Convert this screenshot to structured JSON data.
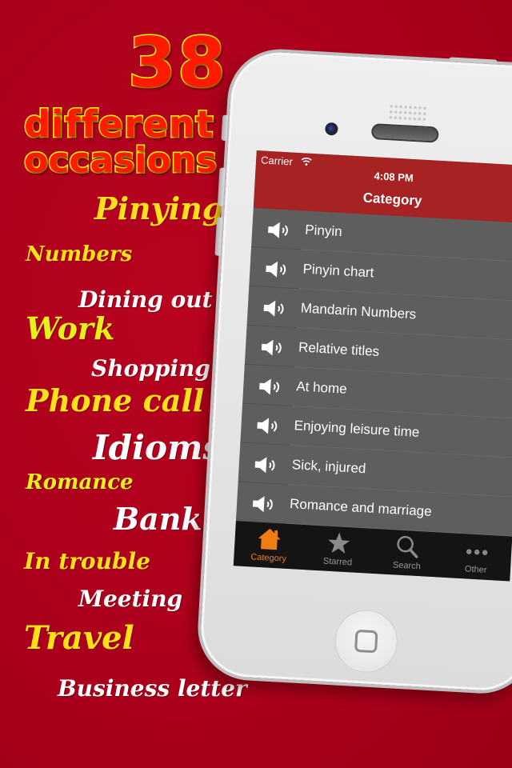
{
  "promo": {
    "headline_number": "38",
    "headline_line1": "different",
    "headline_line2": "occasions",
    "topics": [
      {
        "label": "Pinying",
        "color": "#ffe11a"
      },
      {
        "label": "Numbers",
        "color": "#ffe11a"
      },
      {
        "label": "Dining out",
        "color": "#ffffff"
      },
      {
        "label": "Work",
        "color": "#e6f01a"
      },
      {
        "label": "Shopping",
        "color": "#ffffff"
      },
      {
        "label": "Phone call",
        "color": "#ffe11a"
      },
      {
        "label": "Idioms",
        "color": "#ffffff"
      },
      {
        "label": "Romance",
        "color": "#e6f01a"
      },
      {
        "label": "Bank",
        "color": "#ffffff"
      },
      {
        "label": "In trouble",
        "color": "#ffe11a"
      },
      {
        "label": "Meeting",
        "color": "#ffffff"
      },
      {
        "label": "Travel",
        "color": "#ffe11a"
      },
      {
        "label": "Business letter",
        "color": "#ffffff"
      }
    ]
  },
  "status_bar": {
    "carrier": "Carrier",
    "time": "4:08 PM"
  },
  "nav": {
    "title": "Category"
  },
  "list": {
    "items": [
      {
        "label": "Pinyin",
        "icon": "speaker-icon"
      },
      {
        "label": "Pinyin chart",
        "icon": "speaker-icon"
      },
      {
        "label": "Mandarin Numbers",
        "icon": "speaker-icon"
      },
      {
        "label": "Relative titles",
        "icon": "speaker-icon"
      },
      {
        "label": "At home",
        "icon": "speaker-icon"
      },
      {
        "label": "Enjoying leisure time",
        "icon": "speaker-icon"
      },
      {
        "label": "Sick, injured",
        "icon": "speaker-icon"
      },
      {
        "label": "Romance and marriage",
        "icon": "speaker-icon"
      },
      {
        "label": "",
        "icon": "speaker-icon"
      }
    ],
    "chevron": "›"
  },
  "tabbar": {
    "tabs": [
      {
        "label": "Category",
        "icon": "home-icon",
        "active": true
      },
      {
        "label": "Starred",
        "icon": "star-icon",
        "active": false
      },
      {
        "label": "Search",
        "icon": "search-icon",
        "active": false
      },
      {
        "label": "Other",
        "icon": "more-icon",
        "active": false
      }
    ]
  },
  "colors": {
    "background": "#b0001e",
    "navbar": "#a62223",
    "list_bg": "#5e5e5e",
    "accent": "#f07d12",
    "chevron": "#f2a01e",
    "tabbar": "#141414"
  }
}
